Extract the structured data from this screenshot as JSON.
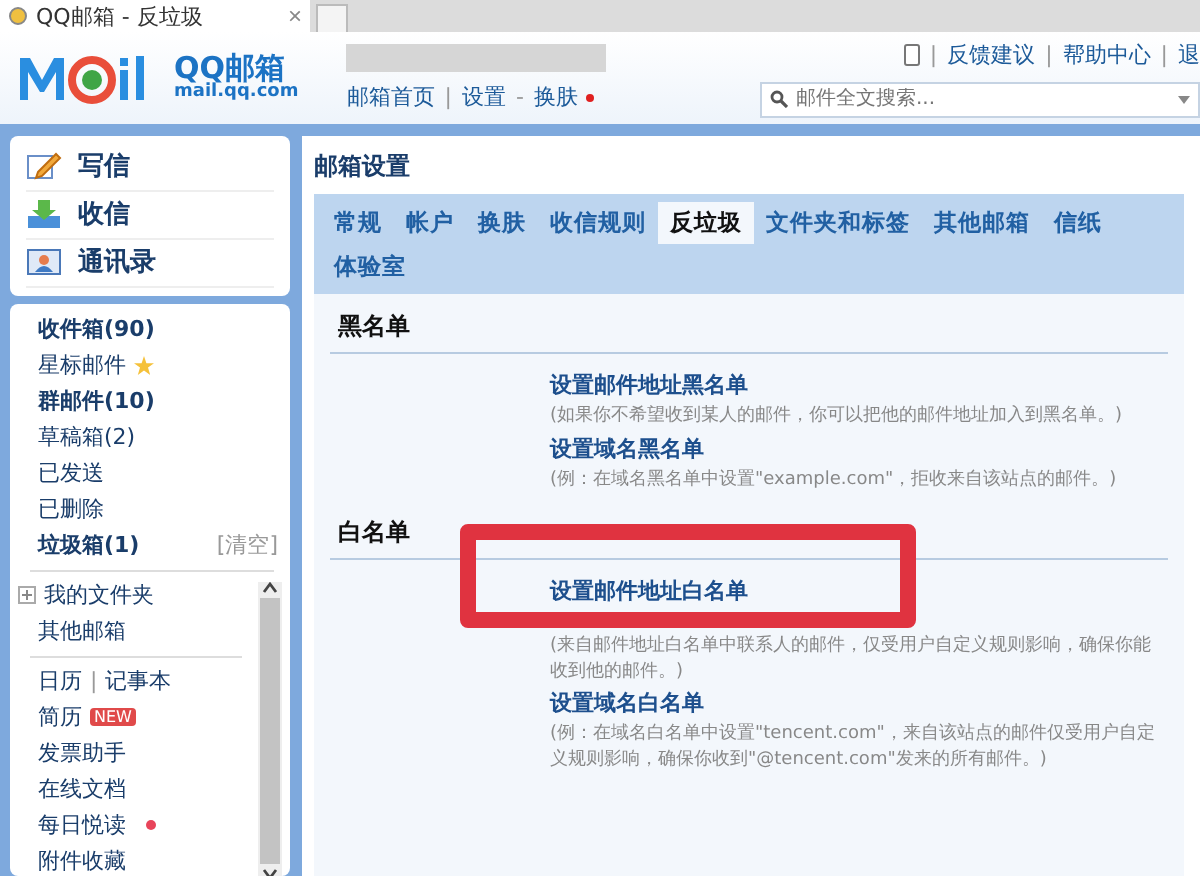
{
  "browser_tab": {
    "title": "QQ邮箱 - 反垃圾",
    "close": "×"
  },
  "header": {
    "logo_text": "QQ邮箱",
    "logo_domain": "mail.qq.com",
    "nav": [
      {
        "label": "邮箱首页",
        "dot": false
      },
      {
        "sep": "|",
        "label": "设置",
        "dot": false
      },
      {
        "sep": "-",
        "label": "换肤",
        "dot": true
      }
    ],
    "top_links": [
      {
        "sep": "|",
        "label": "反馈建议"
      },
      {
        "sep": "|",
        "label": "帮助中心"
      },
      {
        "sep": "|",
        "label": "退"
      }
    ],
    "search": {
      "placeholder": "邮件全文搜索..."
    }
  },
  "quick_actions": [
    {
      "label": "写信",
      "kind": "compose"
    },
    {
      "label": "收信",
      "kind": "receive"
    },
    {
      "label": "通讯录",
      "kind": "contacts"
    }
  ],
  "folders": [
    {
      "label": "收件箱(90)",
      "bold": true,
      "kind": "plain"
    },
    {
      "label": "星标邮件",
      "bold": false,
      "kind": "star"
    },
    {
      "label": "群邮件(10)",
      "bold": true,
      "kind": "plain"
    },
    {
      "label": "草稿箱(2)",
      "bold": false,
      "kind": "plain"
    },
    {
      "label": "已发送",
      "bold": false,
      "kind": "plain"
    },
    {
      "label": "已删除",
      "bold": false,
      "kind": "plain"
    },
    {
      "label": "垃圾箱(1)",
      "bold": true,
      "kind": "action",
      "action": "[清空]"
    }
  ],
  "my_folders": {
    "label": "我的文件夹",
    "expanded": false
  },
  "other_mailboxes": "其他邮箱",
  "tools": [
    {
      "label": "日历",
      "kind": "pair",
      "sep": "|",
      "second": "记事本"
    },
    {
      "label": "简历",
      "kind": "new",
      "badge": "NEW"
    },
    {
      "label": "发票助手",
      "kind": "plain"
    },
    {
      "label": "在线文档",
      "kind": "plain"
    },
    {
      "label": "每日悦读",
      "kind": "dot"
    },
    {
      "label": "附件收藏",
      "kind": "plain"
    }
  ],
  "settings": {
    "title": "邮箱设置",
    "tabs": [
      {
        "label": "常规",
        "selected": false
      },
      {
        "label": "帐户",
        "selected": false
      },
      {
        "label": "换肤",
        "selected": false
      },
      {
        "label": "收信规则",
        "selected": false
      },
      {
        "label": "反垃圾",
        "selected": true
      },
      {
        "label": "文件夹和标签",
        "selected": false
      },
      {
        "label": "其他邮箱",
        "selected": false
      },
      {
        "label": "信纸",
        "selected": false
      },
      {
        "label": "体验室",
        "selected": false
      }
    ],
    "sections": [
      {
        "heading": "黑名单",
        "items": [
          {
            "link": "设置邮件地址黑名单",
            "note": "(如果你不希望收到某人的邮件，你可以把他的邮件地址加入到黑名单。)",
            "highlighted": false
          },
          {
            "link": "设置域名黑名单",
            "note": "(例：在域名黑名单中设置\"example.com\"，拒收来自该站点的邮件。)",
            "highlighted": false
          }
        ]
      },
      {
        "heading": "白名单",
        "items": [
          {
            "link": "设置邮件地址白名单",
            "note": "(来自邮件地址白名单中联系人的邮件，仅受用户自定义规则影响，确保你能收到他的邮件。)",
            "highlighted": true
          },
          {
            "link": "设置域名白名单",
            "note": "(例：在域名白名单中设置\"tencent.com\"，来自该站点的邮件仅受用户自定义规则影响，确保你收到\"@tencent.com\"发来的所有邮件。)",
            "highlighted": false
          }
        ]
      }
    ]
  }
}
